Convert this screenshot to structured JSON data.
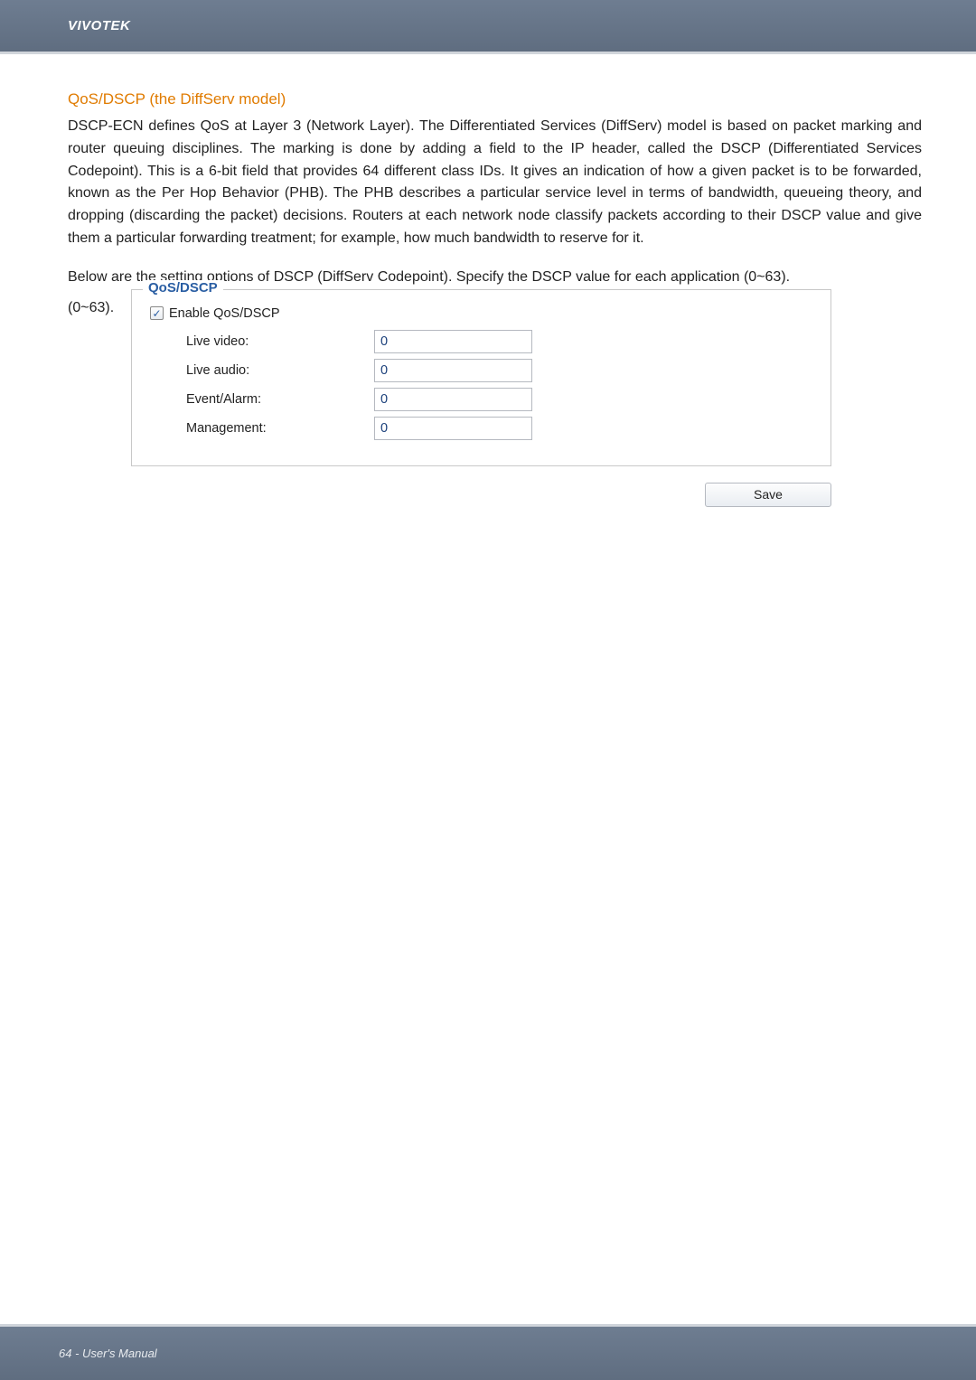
{
  "header": {
    "brand": "VIVOTEK"
  },
  "section": {
    "title": "QoS/DSCP (the DiffServ model)",
    "paragraph1": "DSCP-ECN defines QoS at Layer 3 (Network Layer). The Differentiated Services (DiffServ) model is based on packet marking and router queuing disciplines. The marking is done by adding a field to the IP header, called the DSCP (Differentiated Services Codepoint). This is a 6-bit field that provides 64 different class IDs. It gives an indication of how a given packet is to be forwarded, known as the Per Hop Behavior (PHB). The PHB describes a particular service level in terms of bandwidth, queueing theory, and dropping (discarding the packet) decisions. Routers at each network node classify packets according to their DSCP value and give them a particular forwarding treatment; for example, how much bandwidth to reserve for it.",
    "paragraph2": "Below are the setting options of DSCP (DiffServ Codepoint). Specify the DSCP value for each application (0~63).",
    "range_prefix": "(0~63)."
  },
  "panel": {
    "legend": "QoS/DSCP",
    "enable_label": "Enable QoS/DSCP",
    "fields": [
      {
        "label": "Live video:",
        "value": "0"
      },
      {
        "label": "Live audio:",
        "value": "0"
      },
      {
        "label": "Event/Alarm:",
        "value": "0"
      },
      {
        "label": "Management:",
        "value": "0"
      }
    ],
    "save_label": "Save"
  },
  "footer": {
    "text": "64 - User's Manual"
  }
}
